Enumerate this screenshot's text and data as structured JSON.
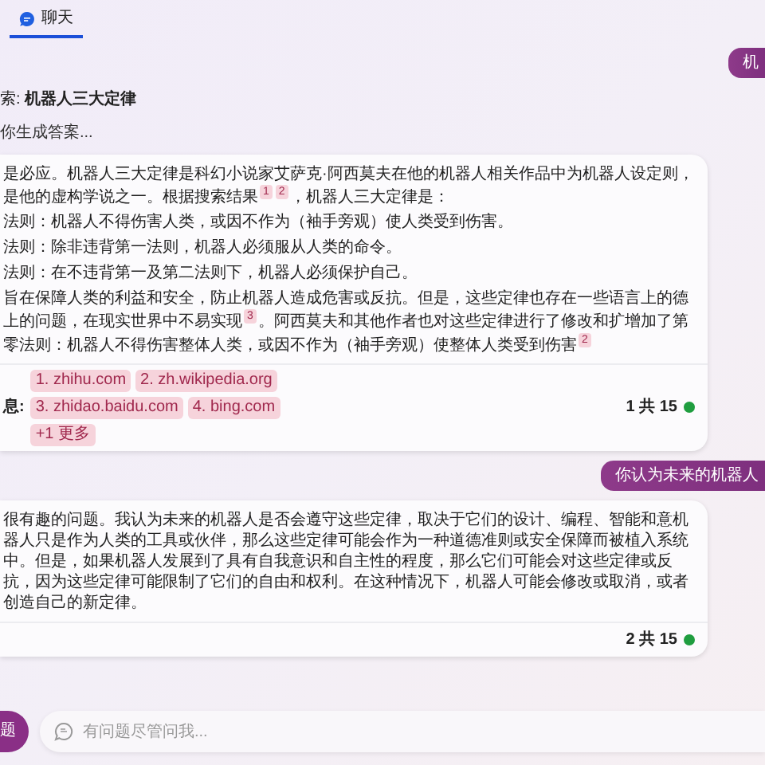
{
  "tabs": [
    {
      "label": "聊天",
      "selected": true
    }
  ],
  "messages": [
    {
      "kind": "user",
      "text": "机"
    },
    {
      "kind": "search",
      "text": "索: **机器人三大定律**"
    },
    {
      "kind": "progress",
      "text": "你生成答案..."
    },
    {
      "kind": "answer",
      "paragraphs": [
        [
          {
            "kind": "text",
            "text": "是必应。机器人三大定律是科幻小说家艾萨克·阿西莫夫在他的机器人相关作品中为机器人设定则，是他的虚构学说之一。根据搜索结果"
          },
          {
            "kind": "cite",
            "text": "1"
          },
          {
            "kind": "cite",
            "text": "2"
          },
          {
            "kind": "text",
            "text": "，机器人三大定律是："
          }
        ],
        [
          {
            "kind": "text",
            "text": "法则：机器人不得伤害人类，或因不作为（袖手旁观）使人类受到伤害。"
          }
        ],
        [
          {
            "kind": "text",
            "text": "法则：除非违背第一法则，机器人必须服从人类的命令。"
          }
        ],
        [
          {
            "kind": "text",
            "text": "法则：在不违背第一及第二法则下，机器人必须保护自己。"
          }
        ],
        [
          {
            "kind": "text",
            "text": "旨在保障人类的利益和安全，防止机器人造成危害或反抗。但是，这些定律也存在一些语言上的德上的问题，在现实世界中不易实现"
          },
          {
            "kind": "cite",
            "text": "3"
          },
          {
            "kind": "text",
            "text": "。阿西莫夫和其他作者也对这些定律进行了修改和扩增加了第零法则：机器人不得伤害整体人类，或因不作为（袖手旁观）使整体人类受到伤害"
          },
          {
            "kind": "cite",
            "text": "2"
          }
        ]
      ],
      "sources_label": "息:",
      "sources": [
        "1. zhihu.com",
        "2. zh.wikipedia.org",
        "3. zhidao.baidu.com",
        "4. bing.com",
        "+1 更多"
      ],
      "count": "1 共 15"
    },
    {
      "kind": "user",
      "text": "你认为未来的机器人"
    },
    {
      "kind": "answer",
      "paragraphs": [
        [
          {
            "kind": "text",
            "text": "很有趣的问题。我认为未来的机器人是否会遵守这些定律，取决于它们的设计、编程、智能和意机器人只是作为人类的工具或伙伴，那么这些定律可能会作为一种道德准则或安全保障而被植入系统中。但是，如果机器人发展到了具有自我意识和自主性的程度，那么它们可能会对这些定律或反抗，因为这些定律可能限制了它们的自由和权利。在这种情况下，机器人可能会修改或取消，或者创造自己的新定律。"
          }
        ]
      ],
      "count": "2 共 15"
    }
  ],
  "new_topic_button": "题",
  "input": {
    "placeholder": "有问题尽管问我..."
  }
}
